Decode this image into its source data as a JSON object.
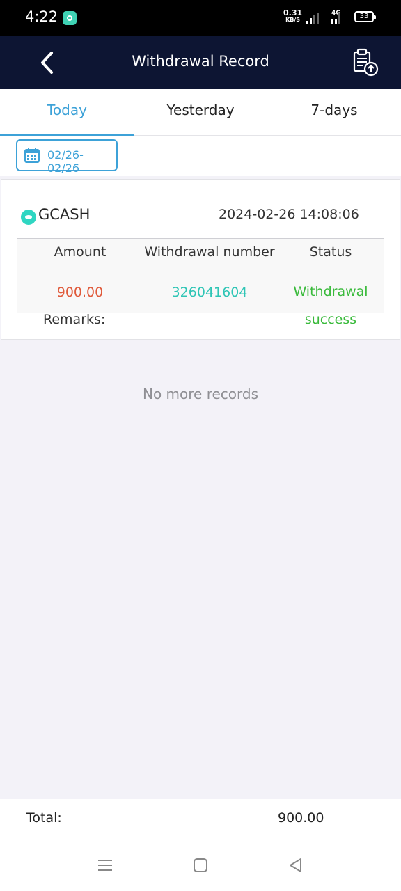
{
  "status_bar": {
    "time": "4:22",
    "speed_value": "0.31",
    "speed_unit": "KB/S",
    "network": "4G",
    "battery": "33"
  },
  "header": {
    "title": "Withdrawal Record",
    "back_icon": "chevron-left-icon",
    "action_icon": "clipboard-upload-icon"
  },
  "tabs": [
    {
      "label": "Today",
      "active": true
    },
    {
      "label": "Yesterday",
      "active": false
    },
    {
      "label": "7-days",
      "active": false
    }
  ],
  "date_filter": {
    "range": "02/26- 02/26",
    "icon": "calendar-icon"
  },
  "record": {
    "method": "GCASH",
    "datetime": "2024-02-26 14:08:06",
    "columns": {
      "amount": "Amount",
      "number": "Withdrawal number",
      "status": "Status"
    },
    "values": {
      "amount": "900.00",
      "number": "326041604",
      "status_line1": "Withdrawal",
      "status_line2": "success"
    },
    "remarks_label": "Remarks:"
  },
  "no_more_text": "No more records",
  "footer": {
    "total_label": "Total:",
    "total_value": "900.00"
  },
  "colors": {
    "header_bg": "#0d1533",
    "accent": "#3da2d8",
    "amount": "#e05a3b",
    "number": "#2ec5b5",
    "success": "#3aba3c"
  }
}
